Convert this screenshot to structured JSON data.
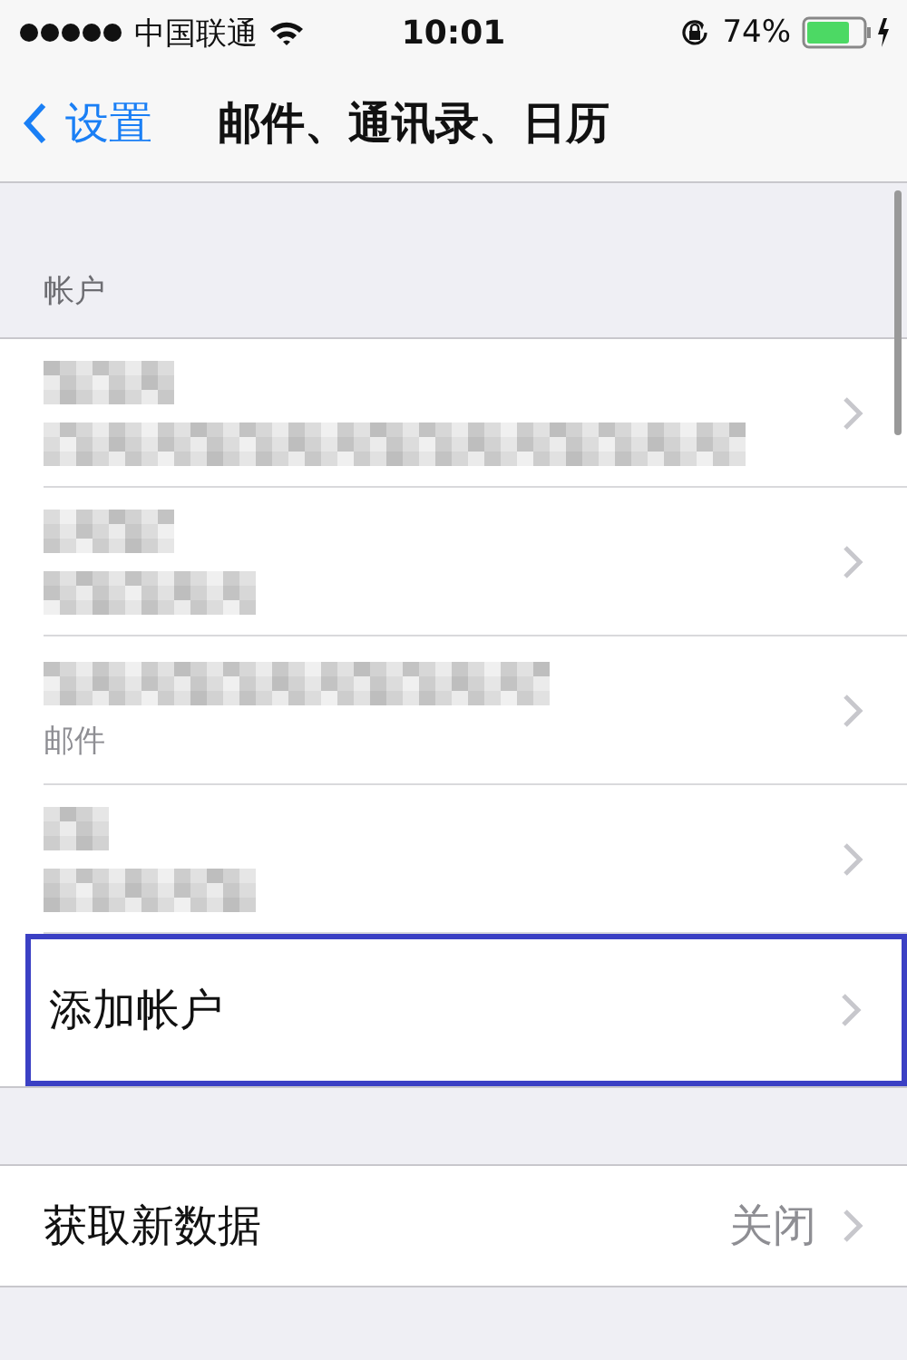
{
  "status_bar": {
    "carrier": "中国联通",
    "time": "10:01",
    "battery": "74%"
  },
  "nav": {
    "back": "设置",
    "title": "邮件、通讯录、日历"
  },
  "section": {
    "header": "帐户",
    "accounts": [
      {
        "kind": "blurred"
      },
      {
        "kind": "blurred"
      },
      {
        "kind": "detail",
        "detail": "邮件"
      },
      {
        "kind": "blurred"
      }
    ],
    "add": {
      "label": "添加帐户",
      "highlighted": true
    }
  },
  "fetch": {
    "label": "获取新数据",
    "value": "关闭"
  }
}
